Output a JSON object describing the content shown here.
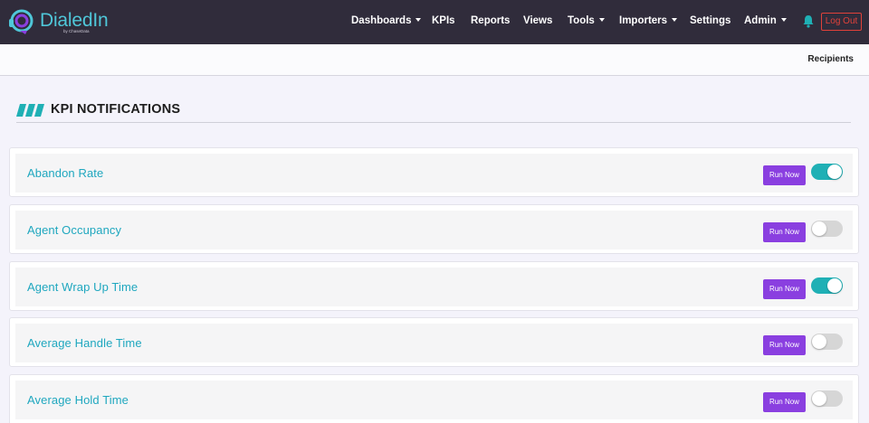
{
  "app": {
    "logo_text": "DialedIn",
    "logo_subtext": "by ChaseData"
  },
  "nav": {
    "items": [
      {
        "label": "Dashboards",
        "dropdown": true
      },
      {
        "label": "KPIs",
        "dropdown": false
      },
      {
        "label": "Reports",
        "dropdown": false
      },
      {
        "label": "Views",
        "dropdown": false
      },
      {
        "label": "Tools",
        "dropdown": true
      },
      {
        "label": "Importers",
        "dropdown": true
      },
      {
        "label": "Settings",
        "dropdown": false
      },
      {
        "label": "Admin",
        "dropdown": true
      }
    ],
    "bell_icon": "bell-icon",
    "logout_label": "Log Out"
  },
  "subnav": {
    "recipients_label": "Recipients"
  },
  "section": {
    "title": "KPI NOTIFICATIONS",
    "icon": "stripes-icon"
  },
  "kpis": [
    {
      "name": "Abandon Rate",
      "run_label": "Run Now",
      "enabled": true
    },
    {
      "name": "Agent Occupancy",
      "run_label": "Run Now",
      "enabled": false
    },
    {
      "name": "Agent Wrap Up Time",
      "run_label": "Run Now",
      "enabled": true
    },
    {
      "name": "Average Handle Time",
      "run_label": "Run Now",
      "enabled": false
    },
    {
      "name": "Average Hold Time",
      "run_label": "Run Now",
      "enabled": false
    }
  ],
  "colors": {
    "navbar": "#302c3b",
    "accent_teal": "#1fa7bf",
    "run_button": "#8a3fe0",
    "toggle_on": "#1fb0b5",
    "logout": "#e0413a"
  }
}
